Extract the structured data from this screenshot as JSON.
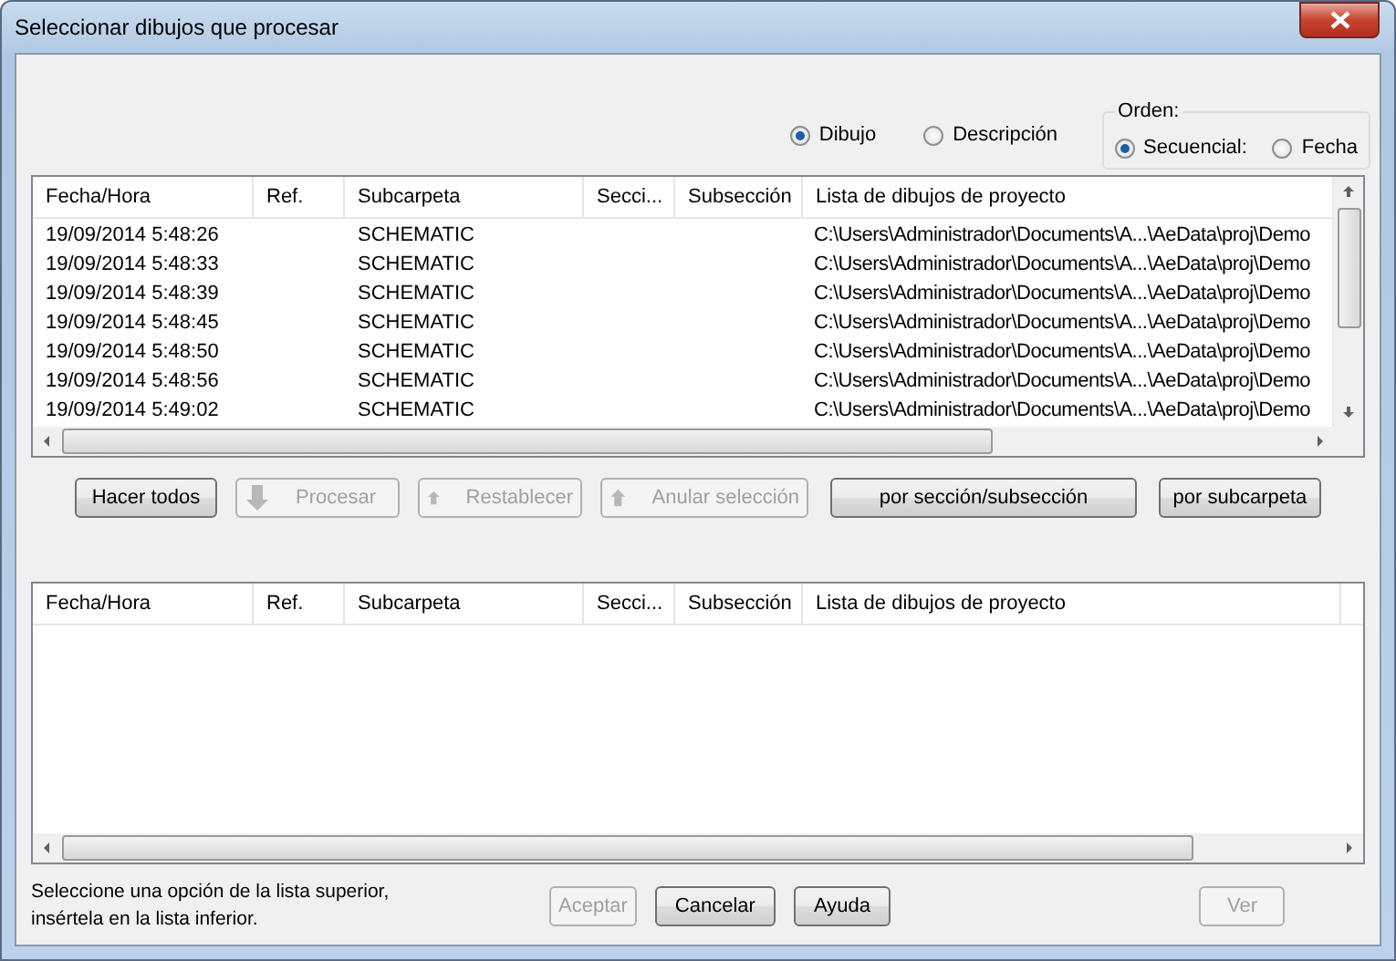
{
  "window": {
    "title": "Seleccionar dibujos que procesar"
  },
  "view_options": [
    {
      "label": "Dibujo",
      "selected": true
    },
    {
      "label": "Descripción",
      "selected": false
    }
  ],
  "order": {
    "title": "Orden:",
    "options": [
      {
        "label": "Secuencial:",
        "selected": true
      },
      {
        "label": "Fecha",
        "selected": false
      }
    ]
  },
  "top_list": {
    "columns": [
      "Fecha/Hora",
      "Ref.",
      "Subcarpeta",
      "Secci...",
      "Subsección",
      "Lista de dibujos de proyecto"
    ],
    "rows": [
      [
        "19/09/2014 5:48:26",
        "",
        "SCHEMATIC",
        "",
        "",
        "C:\\Users\\Administrador\\Documents\\A...\\AeData\\proj\\Demo"
      ],
      [
        "19/09/2014 5:48:33",
        "",
        "SCHEMATIC",
        "",
        "",
        "C:\\Users\\Administrador\\Documents\\A...\\AeData\\proj\\Demo"
      ],
      [
        "19/09/2014 5:48:39",
        "",
        "SCHEMATIC",
        "",
        "",
        "C:\\Users\\Administrador\\Documents\\A...\\AeData\\proj\\Demo"
      ],
      [
        "19/09/2014 5:48:45",
        "",
        "SCHEMATIC",
        "",
        "",
        "C:\\Users\\Administrador\\Documents\\A...\\AeData\\proj\\Demo"
      ],
      [
        "19/09/2014 5:48:50",
        "",
        "SCHEMATIC",
        "",
        "",
        "C:\\Users\\Administrador\\Documents\\A...\\AeData\\proj\\Demo"
      ],
      [
        "19/09/2014 5:48:56",
        "",
        "SCHEMATIC",
        "",
        "",
        "C:\\Users\\Administrador\\Documents\\A...\\AeData\\proj\\Demo"
      ],
      [
        "19/09/2014 5:49:02",
        "",
        "SCHEMATIC",
        "",
        "",
        "C:\\Users\\Administrador\\Documents\\A...\\AeData\\proj\\Demo"
      ]
    ]
  },
  "actions": [
    {
      "label": "Hacer todos",
      "kind": "plain",
      "disabled": false
    },
    {
      "label": "Procesar",
      "kind": "down",
      "disabled": true
    },
    {
      "label": "Restablecer",
      "kind": "up",
      "disabled": true
    },
    {
      "label": "Anular selección",
      "kind": "up",
      "disabled": true
    },
    {
      "label": "por sección/subsección",
      "kind": "plain",
      "disabled": false
    },
    {
      "label": "por subcarpeta",
      "kind": "plain",
      "disabled": false
    }
  ],
  "bottom_list": {
    "columns": [
      "Fecha/Hora",
      "Ref.",
      "Subcarpeta",
      "Secci...",
      "Subsección",
      "Lista de dibujos de proyecto"
    ]
  },
  "hint": [
    "Seleccione una opción de la lista superior,",
    "insértela en la lista inferior."
  ],
  "footer_buttons": [
    {
      "label": "Aceptar",
      "disabled": true
    },
    {
      "label": "Cancelar",
      "disabled": false
    },
    {
      "label": "Ayuda",
      "disabled": false
    }
  ],
  "view_button": {
    "label": "Ver",
    "disabled": true
  }
}
